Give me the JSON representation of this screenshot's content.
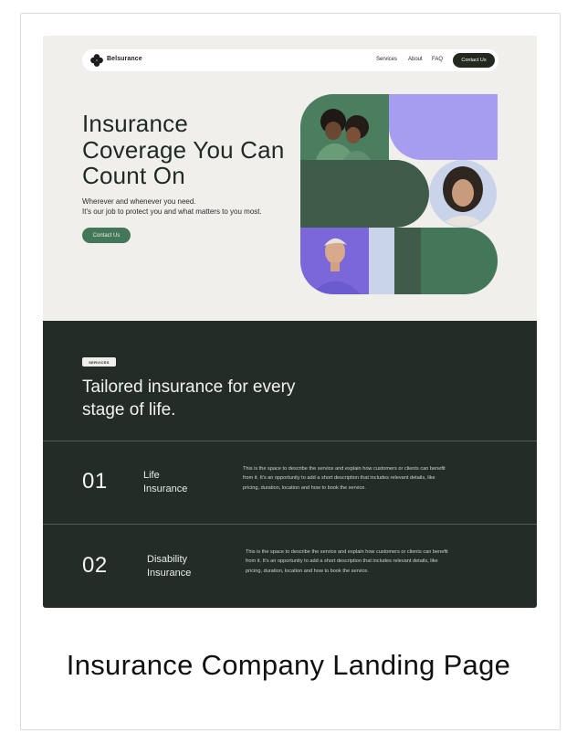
{
  "nav": {
    "brand": "Belsurance",
    "links": [
      "Services",
      "About",
      "FAQ"
    ],
    "cta": "Contact Us"
  },
  "hero": {
    "title": "Insurance Coverage You Can Count On",
    "subtitle_line1": "Wherever and whenever you need.",
    "subtitle_line2": "It's our job to protect you and what matters to you most.",
    "cta": "Contact Us"
  },
  "services": {
    "badge": "SERVICES",
    "title": "Tailored insurance for every stage of life.",
    "items": [
      {
        "number": "01",
        "name_line1": "Life",
        "name_line2": "Insurance",
        "description": "This is the space to describe the service and explain how customers or clients can benefit from it. It's an opportunity to add a short description that includes relevant details, like pricing, duration, location and how to book the service."
      },
      {
        "number": "02",
        "name_line1": "Disability",
        "name_line2": "Insurance",
        "description": "This is the space to describe the service and explain how customers or clients can benefit from it. It's an opportunity to add a short description that includes relevant details, like pricing, duration, location and how to book the service."
      }
    ]
  },
  "caption": "Insurance Company Landing Page",
  "colors": {
    "cream": "#f1efeb",
    "dark_green": "#232c26",
    "green": "#44775a",
    "forest": "#3f5c4a",
    "lavender": "#a69df0",
    "pale_blue": "#c9d3ea",
    "purple": "#7b67d9"
  }
}
